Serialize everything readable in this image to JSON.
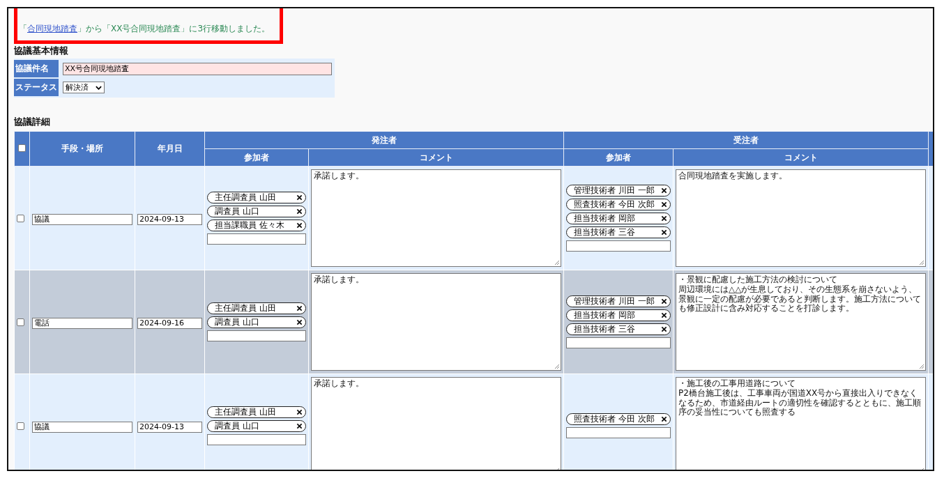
{
  "message": {
    "prefix": "「",
    "link": "合同現地踏査",
    "suffix": "」から「XX号合同現地踏査」に3行移動しました。"
  },
  "basic_info": {
    "title": "協議基本情報",
    "fields": [
      {
        "kind": "text",
        "label": "協議件名",
        "value": "XX号合同現地踏査"
      },
      {
        "kind": "select",
        "label": "ステータス",
        "value": "解決済"
      }
    ]
  },
  "details": {
    "title": "協議詳細",
    "header": {
      "select_all": {
        "checked": false
      },
      "method": "手段・場所",
      "date": "年月日",
      "orderer": "発注者",
      "contractor": "受注者",
      "orderer_participants": "参加者",
      "orderer_comment": "コメント",
      "contractor_participants": "参加者",
      "contractor_comment": "コメント"
    },
    "rows": [
      {
        "selected": false,
        "checked": false,
        "method": "協議",
        "date": "2024-09-13",
        "orderer_participants": [
          "主任調査員 山田",
          "調査員 山口",
          "担当課職員 佐々木"
        ],
        "orderer_comment": [
          "承諾します。"
        ],
        "contractor_participants": [
          "管理技術者 川田 一郎",
          "照査技術者 今田 次郎",
          "担当技術者 岡部",
          "担当技術者 三谷"
        ],
        "contractor_comment": [
          "合同現地踏査を実施します。"
        ]
      },
      {
        "selected": true,
        "checked": false,
        "method": "電話",
        "date": "2024-09-16",
        "orderer_participants": [
          "主任調査員 山田",
          "調査員 山口"
        ],
        "orderer_comment": [
          "承諾します。"
        ],
        "contractor_participants": [
          "管理技術者 川田 一郎",
          "担当技術者 岡部",
          "担当技術者 三谷"
        ],
        "contractor_comment": [
          "・景観に配慮した施工方法の検討について",
          "周辺環境には△△が生息しており、その生態系を崩さないよう、景観に一定の配慮が必要であると判断します。施工方法についても修正設計に含み対応することを打診します。"
        ]
      },
      {
        "selected": false,
        "checked": false,
        "method": "協議",
        "date": "2024-09-13",
        "orderer_participants": [
          "主任調査員 山田",
          "調査員 山口"
        ],
        "orderer_comment": [
          "承諾します。"
        ],
        "contractor_participants": [
          "照査技術者 今田 次郎"
        ],
        "contractor_comment": [
          "・施工後の工事用道路について",
          "P2橋台施工後は、工事車両が国道XX号から直接出入りできなくなるため、市道経由ルートの適切性を確認するとともに、施工順序の妥当性についても照査する"
        ]
      }
    ]
  }
}
